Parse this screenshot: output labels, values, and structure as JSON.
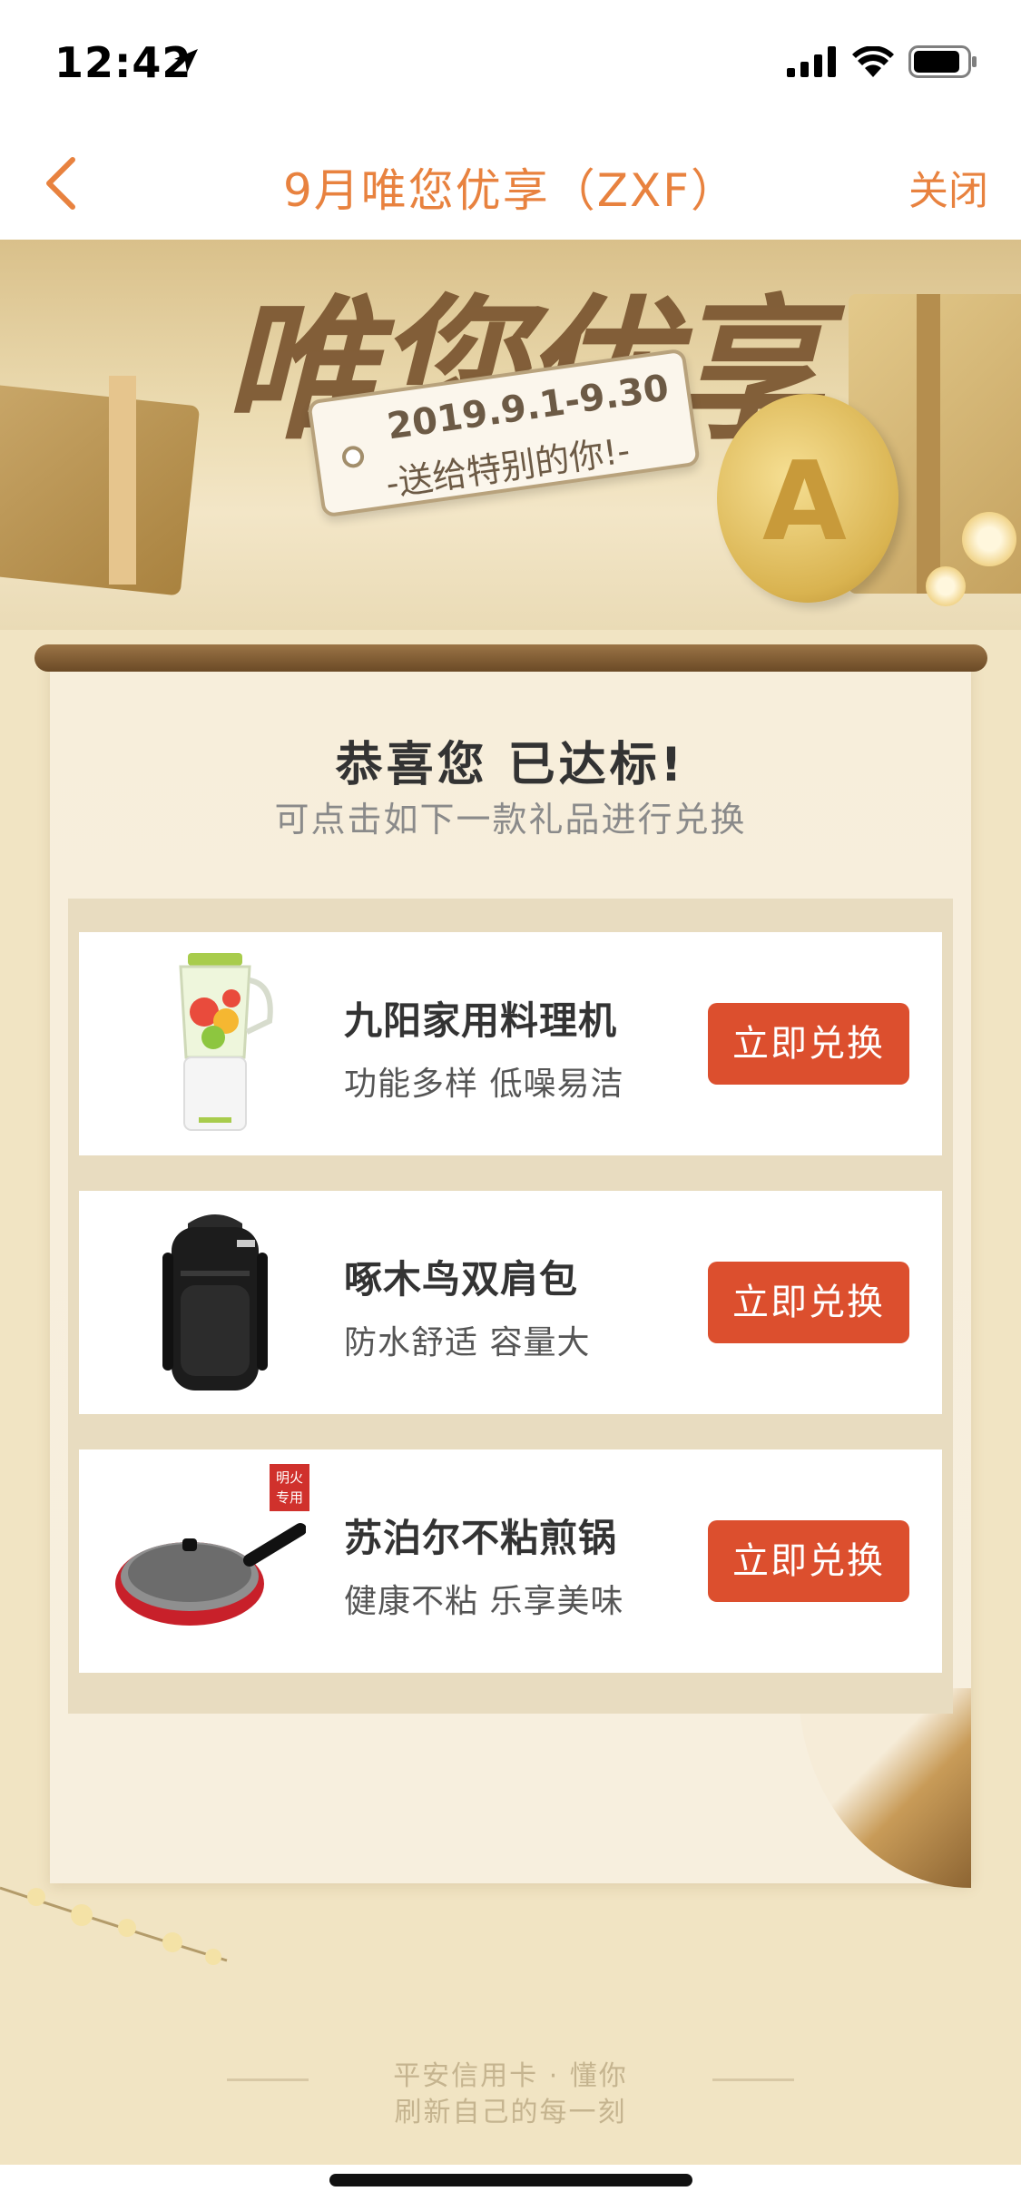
{
  "status_bar": {
    "time": "12:42"
  },
  "nav": {
    "title": "9月唯您优享（ZXF）",
    "close_label": "关闭"
  },
  "banner": {
    "title": "唯您优享",
    "date_range": "2019.9.1-9.30",
    "slogan": "-送给特别的你!-",
    "coin_letter": "A"
  },
  "header": {
    "congrats": "恭喜您 已达标!",
    "subtitle": "可点击如下一款礼品进行兑换"
  },
  "gifts": [
    {
      "name": "九阳家用料理机",
      "desc": "功能多样 低噪易洁",
      "button": "立即兑换",
      "icon": "blender-icon"
    },
    {
      "name": "啄木鸟双肩包",
      "desc": "防水舒适 容量大",
      "button": "立即兑换",
      "icon": "backpack-icon"
    },
    {
      "name": "苏泊尔不粘煎锅",
      "desc": "健康不粘 乐享美味",
      "button": "立即兑换",
      "icon": "frying-pan-icon",
      "badge": "明火专用"
    }
  ],
  "footer": {
    "line1": "平安信用卡 · 懂你",
    "line2": "刷新自己的每一刻"
  },
  "colors": {
    "accent": "#e8823f",
    "button": "#dc4f2e",
    "background": "#f1e4c3"
  }
}
